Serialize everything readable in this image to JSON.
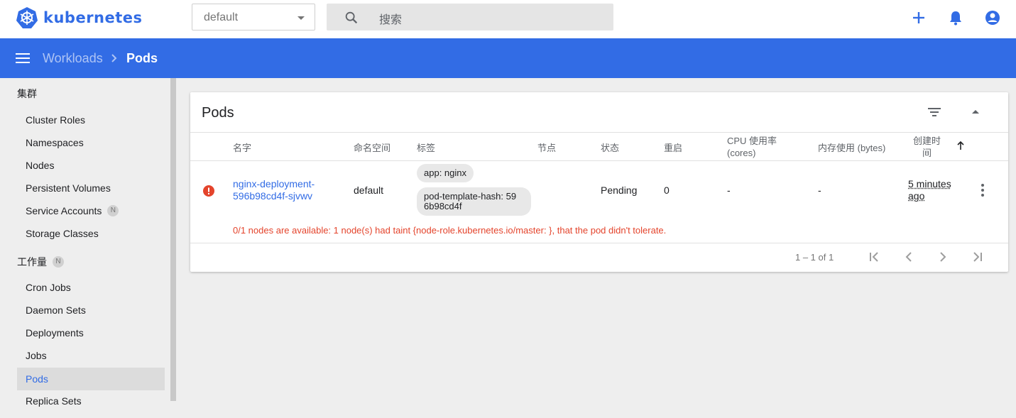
{
  "brand": {
    "name": "kubernetes",
    "color": "#326ce5"
  },
  "namespace_select": {
    "value": "default"
  },
  "search": {
    "placeholder": "搜索"
  },
  "top_actions": [
    "add-icon",
    "notifications-icon",
    "account-icon"
  ],
  "breadcrumb": {
    "parent": "Workloads",
    "current": "Pods"
  },
  "sidebar": {
    "cluster_title": "集群",
    "cluster_items": [
      "Cluster Roles",
      "Namespaces",
      "Nodes",
      "Persistent Volumes",
      "Service Accounts",
      "Storage Classes"
    ],
    "service_accounts_badge": "N",
    "workloads_title": "工作量",
    "workloads_badge": "N",
    "workload_items": [
      "Cron Jobs",
      "Daemon Sets",
      "Deployments",
      "Jobs",
      "Pods",
      "Replica Sets"
    ],
    "active_item": "Pods"
  },
  "card": {
    "title": "Pods",
    "columns": {
      "name": "名字",
      "namespace": "命名空间",
      "labels": "标签",
      "node": "节点",
      "status": "状态",
      "restarts": "重启",
      "cpu_line1": "CPU 使用率",
      "cpu_line2": "(cores)",
      "memory": "内存使用 (bytes)",
      "created_line1": "创建时",
      "created_line2": "间"
    },
    "rows": [
      {
        "name_line1": "nginx-deployment-",
        "name_line2": "596b98cd4f-sjvwv",
        "namespace": "default",
        "label1": "app: nginx",
        "label2_line1": "pod-template-hash: 59",
        "label2_line2": "6b98cd4f",
        "node": "",
        "status": "Pending",
        "restarts": "0",
        "cpu": "-",
        "memory": "-",
        "created_line1": "5 minutes",
        "created_line2": "ago",
        "error": "0/1 nodes are available: 1 node(s) had taint {node-role.kubernetes.io/master: }, that the pod didn't tolerate."
      }
    ],
    "pagination": {
      "range": "1 – 1 of 1"
    }
  },
  "colors": {
    "error": "#e4442c",
    "appbar": "#326ce5",
    "active_nav_bg": "#dcdcdc"
  }
}
